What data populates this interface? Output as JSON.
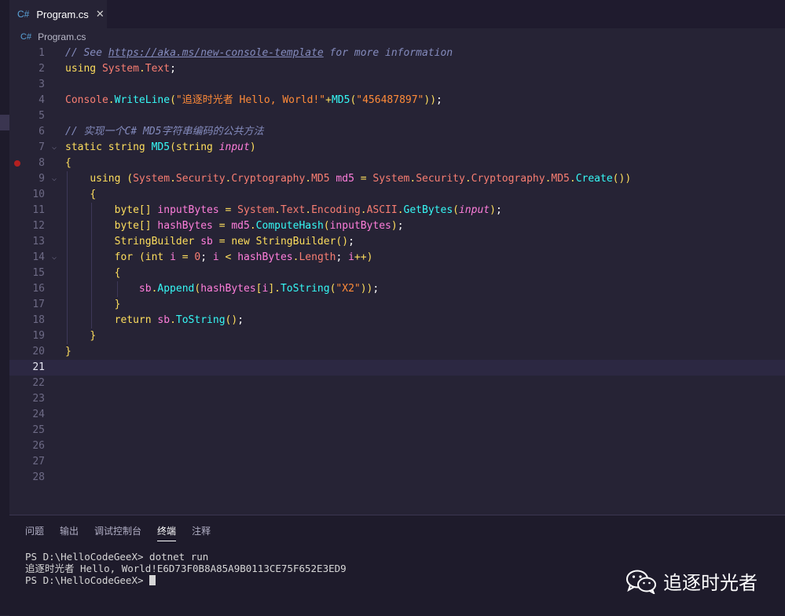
{
  "tab": {
    "icon": "C#",
    "label": "Program.cs",
    "close": "✕"
  },
  "breadcrumb": {
    "icon": "C#",
    "label": "Program.cs"
  },
  "editor": {
    "current_line": 21,
    "breakpoint_line": 8,
    "lines": [
      {
        "n": "1",
        "tokens": [
          [
            "c-comment",
            "// See "
          ],
          [
            "c-link",
            "https://aka.ms/new-console-template"
          ],
          [
            "c-comment",
            " for more information"
          ]
        ]
      },
      {
        "n": "2",
        "tokens": [
          [
            "c-kw",
            "using "
          ],
          [
            "c-type",
            "System"
          ],
          [
            "c-punct",
            "."
          ],
          [
            "c-type",
            "Text"
          ],
          [
            "c-plain",
            ";"
          ]
        ]
      },
      {
        "n": "3",
        "tokens": []
      },
      {
        "n": "4",
        "tokens": [
          [
            "c-type",
            "Console"
          ],
          [
            "c-punct",
            "."
          ],
          [
            "c-fn",
            "WriteLine"
          ],
          [
            "c-punct",
            "("
          ],
          [
            "c-str",
            "\"追逐时光者 Hello, World!\""
          ],
          [
            "c-op",
            "+"
          ],
          [
            "c-fn",
            "MD5"
          ],
          [
            "c-punct",
            "("
          ],
          [
            "c-str",
            "\"456487897\""
          ],
          [
            "c-punct",
            "))"
          ],
          [
            "c-plain",
            ";"
          ]
        ]
      },
      {
        "n": "5",
        "tokens": []
      },
      {
        "n": "6",
        "tokens": [
          [
            "c-comment",
            "// 实现一个C# MD5字符串编码的公共方法"
          ]
        ]
      },
      {
        "n": "7",
        "fold": true,
        "tokens": [
          [
            "c-kw",
            "static "
          ],
          [
            "c-kw",
            "string "
          ],
          [
            "c-fn",
            "MD5"
          ],
          [
            "c-punct",
            "("
          ],
          [
            "c-kw",
            "string "
          ],
          [
            "c-param",
            "input"
          ],
          [
            "c-punct",
            ")"
          ]
        ]
      },
      {
        "n": "8",
        "tokens": [
          [
            "c-punct",
            "{"
          ]
        ]
      },
      {
        "n": "9",
        "fold": true,
        "tokens": [
          [
            "c-plain",
            "    "
          ],
          [
            "c-kw",
            "using "
          ],
          [
            "c-punct",
            "("
          ],
          [
            "c-type",
            "System"
          ],
          [
            "c-punct",
            "."
          ],
          [
            "c-type",
            "Security"
          ],
          [
            "c-punct",
            "."
          ],
          [
            "c-type",
            "Cryptography"
          ],
          [
            "c-punct",
            "."
          ],
          [
            "c-type",
            "MD5 "
          ],
          [
            "c-var",
            "md5 "
          ],
          [
            "c-op",
            "= "
          ],
          [
            "c-type",
            "System"
          ],
          [
            "c-punct",
            "."
          ],
          [
            "c-type",
            "Security"
          ],
          [
            "c-punct",
            "."
          ],
          [
            "c-type",
            "Cryptography"
          ],
          [
            "c-punct",
            "."
          ],
          [
            "c-type",
            "MD5"
          ],
          [
            "c-punct",
            "."
          ],
          [
            "c-fn",
            "Create"
          ],
          [
            "c-punct",
            "())"
          ]
        ]
      },
      {
        "n": "10",
        "tokens": [
          [
            "c-plain",
            "    "
          ],
          [
            "c-punct",
            "{"
          ]
        ]
      },
      {
        "n": "11",
        "tokens": [
          [
            "c-plain",
            "        "
          ],
          [
            "c-kw",
            "byte[] "
          ],
          [
            "c-var",
            "inputBytes "
          ],
          [
            "c-op",
            "= "
          ],
          [
            "c-type",
            "System"
          ],
          [
            "c-punct",
            "."
          ],
          [
            "c-type",
            "Text"
          ],
          [
            "c-punct",
            "."
          ],
          [
            "c-type",
            "Encoding"
          ],
          [
            "c-punct",
            "."
          ],
          [
            "c-type",
            "ASCII"
          ],
          [
            "c-punct",
            "."
          ],
          [
            "c-fn",
            "GetBytes"
          ],
          [
            "c-punct",
            "("
          ],
          [
            "c-param",
            "input"
          ],
          [
            "c-punct",
            ")"
          ],
          [
            "c-plain",
            ";"
          ]
        ]
      },
      {
        "n": "12",
        "tokens": [
          [
            "c-plain",
            "        "
          ],
          [
            "c-kw",
            "byte[] "
          ],
          [
            "c-var",
            "hashBytes "
          ],
          [
            "c-op",
            "= "
          ],
          [
            "c-var",
            "md5"
          ],
          [
            "c-punct",
            "."
          ],
          [
            "c-fn",
            "ComputeHash"
          ],
          [
            "c-punct",
            "("
          ],
          [
            "c-var",
            "inputBytes"
          ],
          [
            "c-punct",
            ")"
          ],
          [
            "c-plain",
            ";"
          ]
        ]
      },
      {
        "n": "13",
        "tokens": [
          [
            "c-plain",
            "        "
          ],
          [
            "c-kw",
            "StringBuilder "
          ],
          [
            "c-var",
            "sb "
          ],
          [
            "c-op",
            "= "
          ],
          [
            "c-kw",
            "new "
          ],
          [
            "c-kw",
            "StringBuilder"
          ],
          [
            "c-punct",
            "()"
          ],
          [
            "c-plain",
            ";"
          ]
        ]
      },
      {
        "n": "14",
        "fold": true,
        "tokens": [
          [
            "c-plain",
            "        "
          ],
          [
            "c-kw",
            "for "
          ],
          [
            "c-punct",
            "("
          ],
          [
            "c-kw",
            "int "
          ],
          [
            "c-var",
            "i "
          ],
          [
            "c-op",
            "= "
          ],
          [
            "c-num",
            "0"
          ],
          [
            "c-plain",
            "; "
          ],
          [
            "c-var",
            "i "
          ],
          [
            "c-op",
            "< "
          ],
          [
            "c-var",
            "hashBytes"
          ],
          [
            "c-punct",
            "."
          ],
          [
            "c-type",
            "Length"
          ],
          [
            "c-plain",
            "; "
          ],
          [
            "c-var",
            "i"
          ],
          [
            "c-op",
            "++"
          ],
          [
            "c-punct",
            ")"
          ]
        ]
      },
      {
        "n": "15",
        "tokens": [
          [
            "c-plain",
            "        "
          ],
          [
            "c-punct",
            "{"
          ]
        ]
      },
      {
        "n": "16",
        "tokens": [
          [
            "c-plain",
            "            "
          ],
          [
            "c-var",
            "sb"
          ],
          [
            "c-punct",
            "."
          ],
          [
            "c-fn",
            "Append"
          ],
          [
            "c-punct",
            "("
          ],
          [
            "c-var",
            "hashBytes"
          ],
          [
            "c-punct",
            "["
          ],
          [
            "c-var",
            "i"
          ],
          [
            "c-punct",
            "]."
          ],
          [
            "c-fn",
            "ToString"
          ],
          [
            "c-punct",
            "("
          ],
          [
            "c-str",
            "\"X2\""
          ],
          [
            "c-punct",
            "))"
          ],
          [
            "c-plain",
            ";"
          ]
        ]
      },
      {
        "n": "17",
        "tokens": [
          [
            "c-plain",
            "        "
          ],
          [
            "c-punct",
            "}"
          ]
        ]
      },
      {
        "n": "18",
        "tokens": [
          [
            "c-plain",
            "        "
          ],
          [
            "c-kw",
            "return "
          ],
          [
            "c-var",
            "sb"
          ],
          [
            "c-punct",
            "."
          ],
          [
            "c-fn",
            "ToString"
          ],
          [
            "c-punct",
            "()"
          ],
          [
            "c-plain",
            ";"
          ]
        ]
      },
      {
        "n": "19",
        "tokens": [
          [
            "c-plain",
            "    "
          ],
          [
            "c-punct",
            "}"
          ]
        ]
      },
      {
        "n": "20",
        "tokens": [
          [
            "c-punct",
            "}"
          ]
        ]
      },
      {
        "n": "21",
        "tokens": []
      },
      {
        "n": "22",
        "tokens": []
      },
      {
        "n": "23",
        "tokens": []
      },
      {
        "n": "24",
        "tokens": []
      },
      {
        "n": "25",
        "tokens": []
      },
      {
        "n": "26",
        "tokens": []
      },
      {
        "n": "27",
        "tokens": []
      },
      {
        "n": "28",
        "tokens": []
      }
    ]
  },
  "panel": {
    "tabs": [
      {
        "label": "问题",
        "active": false
      },
      {
        "label": "输出",
        "active": false
      },
      {
        "label": "调试控制台",
        "active": false
      },
      {
        "label": "终端",
        "active": true
      },
      {
        "label": "注释",
        "active": false
      }
    ],
    "terminal": {
      "line1": "PS D:\\HelloCodeGeeX> dotnet run",
      "line2": "追逐时光者 Hello, World!E6D73F0B8A85A9B0113CE75F652E3ED9",
      "line3": "PS D:\\HelloCodeGeeX> "
    }
  },
  "watermark": {
    "text": "追逐时光者",
    "icon": "wechat-icon"
  }
}
